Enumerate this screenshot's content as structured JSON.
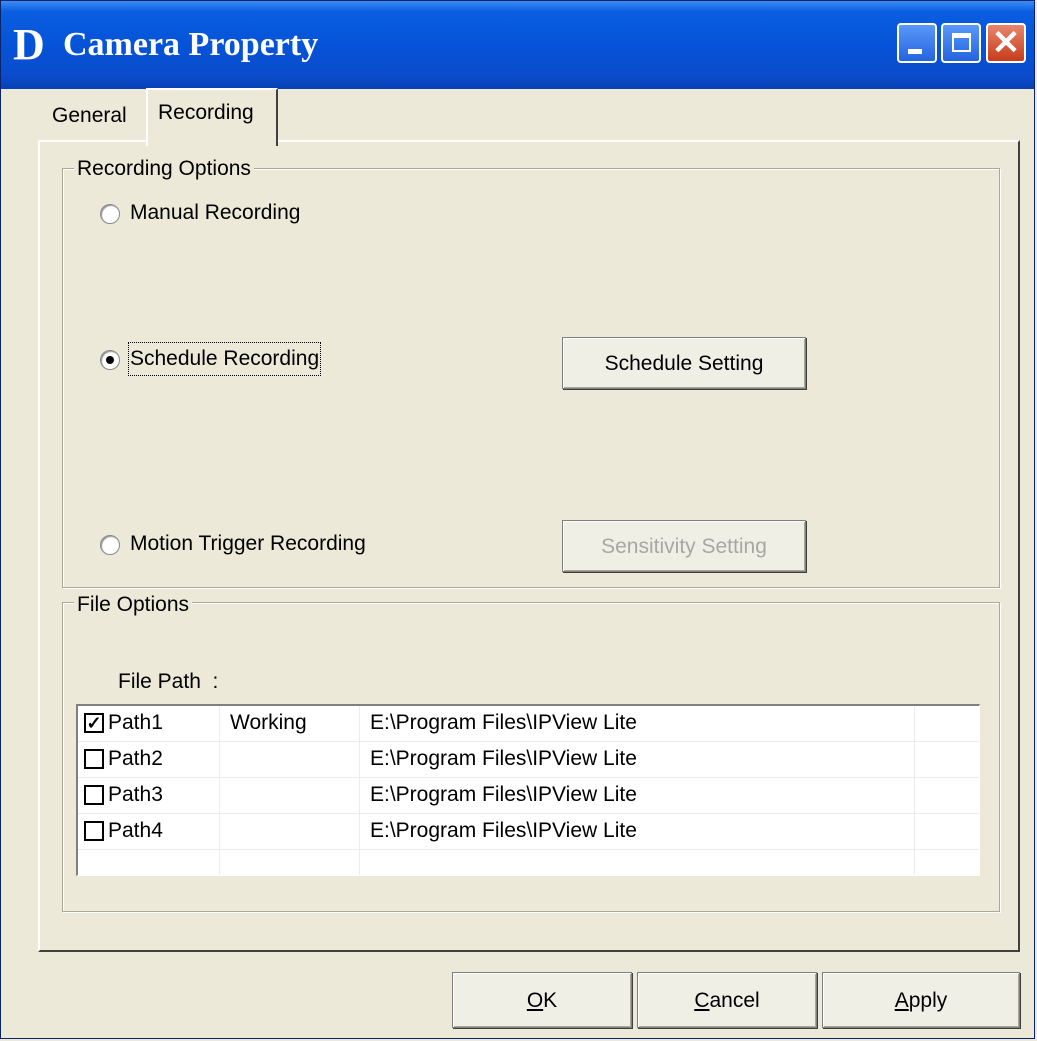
{
  "window": {
    "title": "Camera Property",
    "icon_letter": "D",
    "close_glyph": "✕",
    "accent_color": "#0553d8"
  },
  "tabs": [
    {
      "label": "General",
      "selected": false
    },
    {
      "label": "Recording",
      "selected": true
    }
  ],
  "recording_options": {
    "legend": "Recording Options",
    "manual": {
      "label": "Manual Recording",
      "checked": false
    },
    "schedule": {
      "label": "Schedule Recording",
      "checked": true,
      "button_label": "Schedule Setting"
    },
    "motion": {
      "label": "Motion Trigger Recording",
      "checked": false,
      "button_label": "Sensitivity Setting",
      "button_enabled": false
    }
  },
  "file_options": {
    "legend": "File Options",
    "file_path_label": "File Path  :",
    "paths": [
      {
        "name": "Path1",
        "checked": true,
        "status": "Working",
        "dir": "E:\\Program Files\\IPView Lite"
      },
      {
        "name": "Path2",
        "checked": false,
        "status": "",
        "dir": "E:\\Program Files\\IPView Lite"
      },
      {
        "name": "Path3",
        "checked": false,
        "status": "",
        "dir": "E:\\Program Files\\IPView Lite"
      },
      {
        "name": "Path4",
        "checked": false,
        "status": "",
        "dir": "E:\\Program Files\\IPView Lite"
      }
    ],
    "check_glyph": "✓"
  },
  "buttons": {
    "ok": {
      "mnemonic": "O",
      "rest": "K"
    },
    "cancel": {
      "mnemonic": "C",
      "rest": "ancel"
    },
    "apply": {
      "mnemonic": "A",
      "rest": "pply"
    }
  }
}
